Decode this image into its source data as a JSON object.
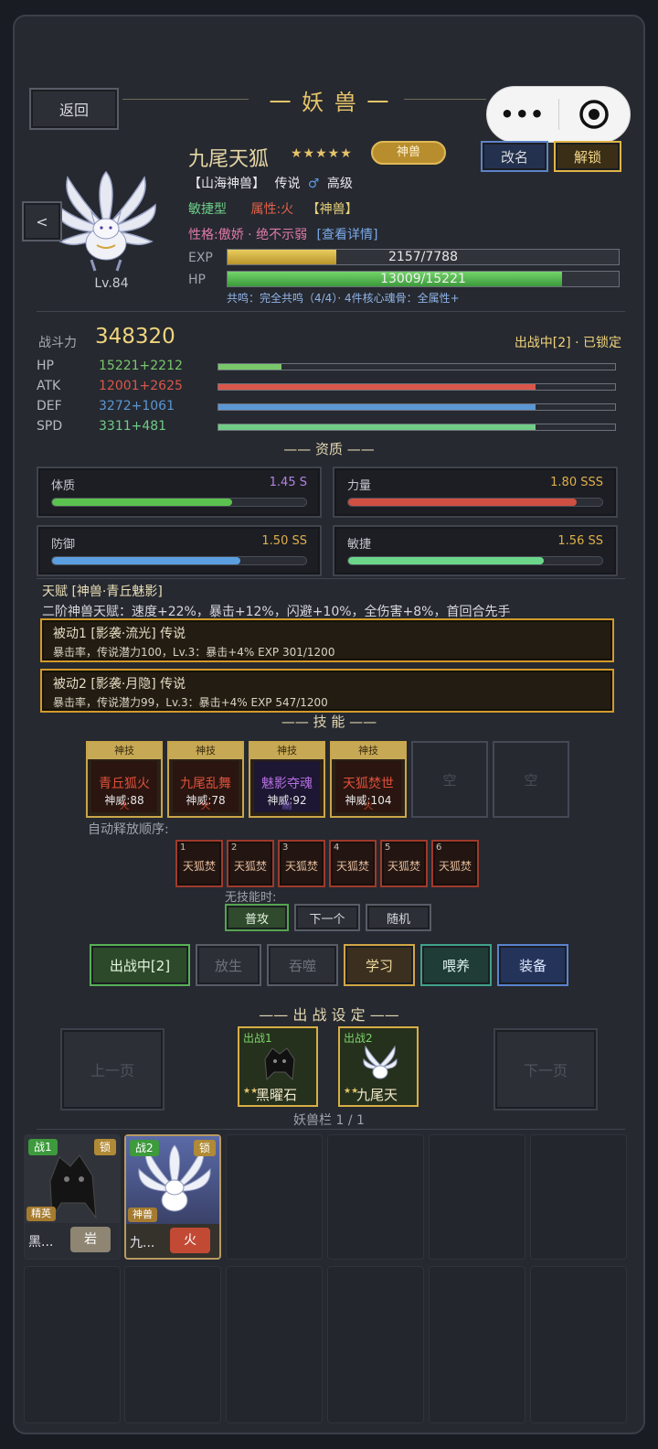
{
  "header": {
    "back_label": "返回",
    "title": "一 妖 兽 一"
  },
  "capsule": {
    "more_icon": "•••",
    "target_icon": "target-icon"
  },
  "pet": {
    "name": "九尾天狐",
    "stars": "★★★★★",
    "rank_badge": "神兽",
    "rename_label": "改名",
    "unlock_label": "解锁",
    "prev_label": "<",
    "line1_source": "【山海神兽】",
    "line1_rarity": "传说",
    "gender_icon": "♂",
    "line1_grade": "高级",
    "type": "敏捷型",
    "attribute": "属性:火",
    "tag": "【神兽】",
    "personality": "性格:傲娇 · 绝不示弱",
    "detail_link": "[查看详情]",
    "level": "Lv.84",
    "exp_label": "EXP",
    "exp_text": "2157/7788",
    "exp_fraction": 0.277,
    "hp_label": "HP",
    "hp_text": "13009/15221",
    "hp_fraction": 0.855,
    "resonance": "共鸣：完全共鸣（4/4）· 4件核心魂骨：全属性+"
  },
  "combat": {
    "label": "战斗力",
    "power": "348320",
    "status": "出战中[2] · 已锁定",
    "stats": [
      {
        "name": "HP",
        "value": "15221+2212",
        "color": "#79c86a",
        "fraction": 0.16
      },
      {
        "name": "ATK",
        "value": "12001+2625",
        "color": "#d9574a",
        "fraction": 0.8
      },
      {
        "name": "DEF",
        "value": "3272+1061",
        "color": "#5b97d4",
        "fraction": 0.8
      },
      {
        "name": "SPD",
        "value": "3311+481",
        "color": "#70cc86",
        "fraction": 0.8
      }
    ]
  },
  "aptitude": {
    "title": "—— 资质 ——",
    "items": [
      {
        "name": "体质",
        "value": "1.45 S",
        "color": "#b582e0",
        "bar": "#5cc24f",
        "fraction": 0.71
      },
      {
        "name": "力量",
        "value": "1.80 SSS",
        "color": "#e0b04a",
        "bar": "#cf4f42",
        "fraction": 0.9
      },
      {
        "name": "防御",
        "value": "1.50 SS",
        "color": "#e0b04a",
        "bar": "#5b9fe0",
        "fraction": 0.74
      },
      {
        "name": "敏捷",
        "value": "1.56 SS",
        "color": "#e0b04a",
        "bar": "#6bd68a",
        "fraction": 0.77
      }
    ]
  },
  "talent": {
    "title": "天赋 [神兽·青丘魅影]",
    "desc": "二阶神兽天赋：速度+22%，暴击+12%，闪避+10%，全伤害+8%，首回合先手",
    "passives": [
      {
        "title": "被动1 [影袭·流光] 传说",
        "desc": "暴击率，传说潜力100，Lv.3：暴击+4%  EXP 301/1200"
      },
      {
        "title": "被动2 [影袭·月隐] 传说",
        "desc": "暴击率，传说潜力99，Lv.3：暴击+4%  EXP 547/1200"
      }
    ]
  },
  "skills": {
    "title": "—— 技 能 ——",
    "slots": [
      {
        "tag": "神技",
        "name": "青丘狐火",
        "power": "神威:88",
        "element": "火",
        "color": "#e0513b"
      },
      {
        "tag": "神技",
        "name": "九尾乱舞",
        "power": "神威:78",
        "element": "火",
        "color": "#e0513b"
      },
      {
        "tag": "神技",
        "name": "魅影夺魂",
        "power": "神威:92",
        "element": "幽",
        "color": "#b46ee0"
      },
      {
        "tag": "神技",
        "name": "天狐焚世",
        "power": "神威:104",
        "element": "火",
        "color": "#e0513b"
      },
      {
        "name": "空"
      },
      {
        "name": "空"
      }
    ],
    "order_label": "自动释放顺序:",
    "order": [
      {
        "n": "1",
        "s": "天狐焚"
      },
      {
        "n": "2",
        "s": "天狐焚"
      },
      {
        "n": "3",
        "s": "天狐焚"
      },
      {
        "n": "4",
        "s": "天狐焚"
      },
      {
        "n": "5",
        "s": "天狐焚"
      },
      {
        "n": "6",
        "s": "天狐焚"
      }
    ],
    "no_skill_label": "无技能时:",
    "fallback": [
      "普攻",
      "下一个",
      "随机"
    ]
  },
  "actions": [
    "出战中[2]",
    "放生",
    "吞噬",
    "学习",
    "喂养",
    "装备"
  ],
  "battle": {
    "title": "—— 出 战 设 定 ——",
    "prev_page": "上一页",
    "next_page": "下一页",
    "slots": [
      {
        "label": "出战1",
        "stars": "★★",
        "name": "黑曜石"
      },
      {
        "label": "出战2",
        "stars": "★★",
        "name": "九尾天"
      }
    ],
    "bag_label": "妖兽栏 1 / 1"
  },
  "inventory": [
    {
      "battle": "战1",
      "lock": "锁",
      "rank": "精英",
      "name": "黑...",
      "element": "岩",
      "element_color": "#8e8573"
    },
    {
      "battle": "战2",
      "lock": "锁",
      "rank": "神兽",
      "name": "九...",
      "element": "火",
      "element_color": "#c24a35"
    }
  ]
}
